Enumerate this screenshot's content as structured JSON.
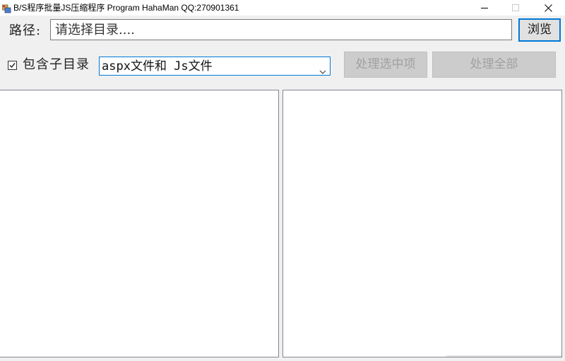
{
  "window": {
    "title": "B/S程序批量JS压缩程序  Program HahaMan QQ:270901361",
    "icon": "app-icon"
  },
  "path": {
    "label": "路径:",
    "placeholder": "请选择目录....",
    "value": "",
    "browse_label": "浏览"
  },
  "options": {
    "include_subdirs_label": "包含子目录",
    "include_subdirs_checked": true,
    "file_type_selected": "aspx文件和 Js文件",
    "process_selected_label": "处理选中项",
    "process_all_label": "处理全部"
  },
  "lists": {
    "left_items": [],
    "right_items": []
  },
  "colors": {
    "accent": "#0078d7",
    "disabled_bg": "#cccccc",
    "disabled_text": "#a0a0a0",
    "window_bg": "#f0f0f0"
  }
}
